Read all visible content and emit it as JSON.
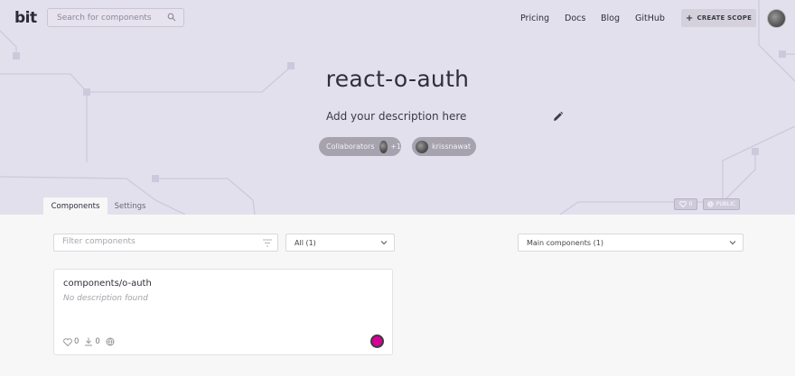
{
  "app": {
    "logo": "bit"
  },
  "header": {
    "search_placeholder": "Search for components",
    "nav": [
      "Pricing",
      "Docs",
      "Blog",
      "GitHub"
    ],
    "create_scope_label": "CREATE SCOPE"
  },
  "scope": {
    "title": "react-o-auth",
    "description": "Add your description here",
    "collaborators_label": "Collaborators",
    "collaborators_extra": "+1",
    "owner_name": "krissnawat",
    "likes": "0",
    "visibility": "PUBLIC"
  },
  "tabs": [
    "Components",
    "Settings"
  ],
  "filters": {
    "filter_placeholder": "Filter components",
    "all_select": "All (1)",
    "main_select": "Main components (1)"
  },
  "components": [
    {
      "name": "components/o-auth",
      "description": "No description found",
      "likes": "0",
      "downloads": "0"
    }
  ],
  "colors": {
    "hero_bg": "#e3e0ed",
    "page_bg": "#f7f7f8",
    "env_dot": "#d40097"
  },
  "icons": [
    "search-icon",
    "plus-icon",
    "pencil-icon",
    "heart-icon",
    "globe-icon",
    "filter-icon",
    "chevron-down-icon",
    "download-icon"
  ]
}
